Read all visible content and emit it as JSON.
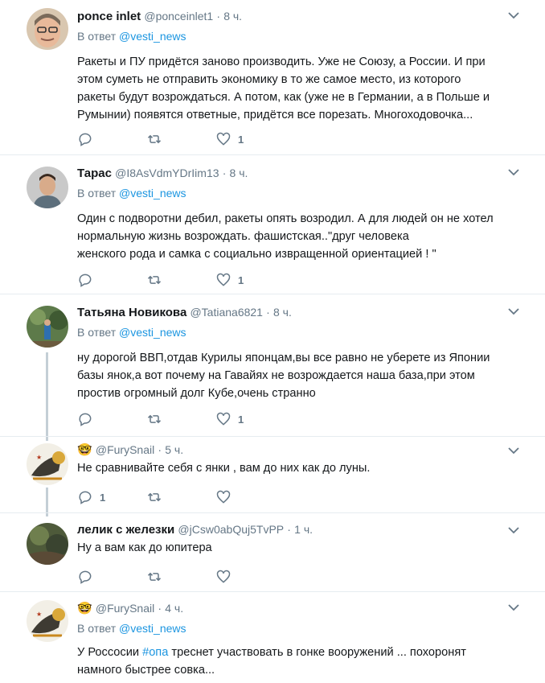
{
  "tweets": [
    {
      "name": "ponce inlet",
      "handle": "@ponceinlet1",
      "time": "8 ч.",
      "reply_prefix": "В ответ",
      "reply_to": "@vesti_news",
      "lines": [
        "Ракеты и ПУ придётся заново производить. Уже не Союзу, а России. И при",
        "этом суметь не отправить экономику в то же самое место, из которого",
        "ракеты будут возрождаться. А потом, как (уже не в Германии, а в Польше и",
        "Румынии) появятся ответные, придётся все порезать. Многоходовочка..."
      ],
      "replies": "",
      "retweets": "",
      "likes": "1"
    },
    {
      "name": "Тарас",
      "handle": "@I8AsVdmYDrIim13",
      "time": "8 ч.",
      "reply_prefix": "В ответ",
      "reply_to": "@vesti_news",
      "lines": [
        "Один с подворотни дебил, ракеты опять возродил. А для людей он не хотел",
        "нормальную жизнь возрождать. фашистская..\"друг человека",
        "женского рода и самка с социально извращенной ориентацией ! \""
      ],
      "replies": "",
      "retweets": "",
      "likes": "1"
    },
    {
      "name": "Татьяна Новикова",
      "handle": "@Tatiana6821",
      "time": "8 ч.",
      "reply_prefix": "В ответ",
      "reply_to": "@vesti_news",
      "lines": [
        "ну дорогой ВВП,отдав Курилы японцам,вы все равно не уберете из Японии",
        "базы янок,а вот почему на Гавайях не возрождается наша база,при этом",
        "простив огромный долг Кубе,очень странно"
      ],
      "replies": "",
      "retweets": "",
      "likes": "1"
    },
    {
      "name": "🤓",
      "handle": "@FurySnail",
      "time": "5 ч.",
      "lines": [
        "Не сравнивайте себя с янки , вам до них как до луны."
      ],
      "replies": "1",
      "retweets": "",
      "likes": ""
    },
    {
      "name": "лелик с железки",
      "handle": "@jCsw0abQuj5TvPP",
      "time": "1 ч.",
      "lines": [
        "Ну а вам как до юпитера"
      ],
      "replies": "",
      "retweets": "",
      "likes": ""
    },
    {
      "name": "🤓",
      "handle": "@FurySnail",
      "time": "4 ч.",
      "reply_prefix": "В ответ",
      "reply_to": "@vesti_news",
      "text_before": "У Россоcии ",
      "hashtag": "#опа",
      "text_after": " треснет участвовать в гонке вооружений ... похоронят",
      "lines": [
        "намного быстрее совка..."
      ],
      "replies": "",
      "retweets": "",
      "likes": ""
    }
  ],
  "colors": {
    "link": "#1b95e0",
    "muted": "#657786",
    "separator": "#e6ecf0",
    "thread": "#c4cfd6"
  },
  "icons": {
    "reply": "reply-icon",
    "retweet": "retweet-icon",
    "like": "heart-icon",
    "menu": "chevron-down-icon"
  }
}
